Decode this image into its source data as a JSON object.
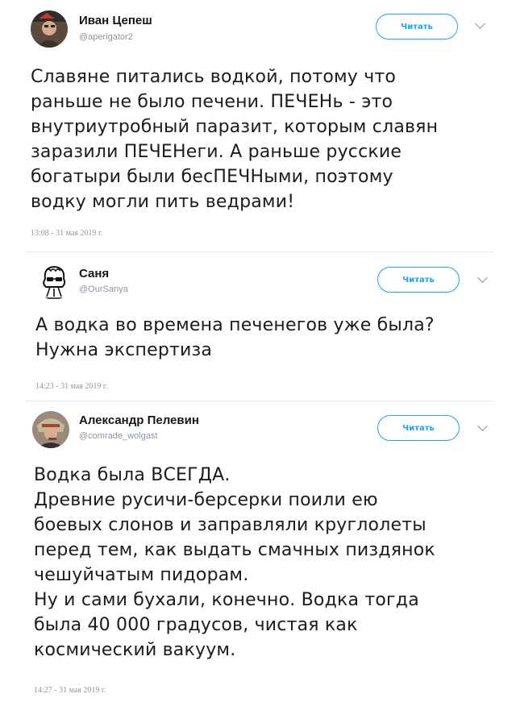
{
  "tweets": [
    {
      "name": "Иван Цепеш",
      "handle": "@aperigator2",
      "follow_label": "Читать",
      "text": "Славяне питались водкой, потому что\nраньше не было печени. ПЕЧЕНь - это\nвнутриутробный паразит, которым славян\nзаразили ПЕЧЕНеги. А раньше русские\nбогатыри были бесПЕЧНыми, поэтому\nводку могли пить ведрами!",
      "timestamp": "13:08 - 31 мая 2019 г."
    },
    {
      "name": "Саня",
      "handle": "@OurSanya",
      "follow_label": "Читать",
      "text": "А водка во времена печенегов уже была?\nНужна экспертиза",
      "timestamp": "14:23 - 31 мая 2019 г."
    },
    {
      "name": "Александр Пелевин",
      "handle": "@comrade_wolgast",
      "follow_label": "Читать",
      "text": "Водка была ВСЕГДА.\nДревние русичи-берсерки поили ею\nбоевых слонов и заправляли круглолеты\nперед тем, как выдать смачных пиздянок\nчешуйчатым пидорам.\nНу и сами бухали, конечно. Водка тогда\nбыла 40 000 градусов, чистая как\nкосмический вакуум.",
      "timestamp": "14:27 - 31 мая 2019 г."
    }
  ],
  "icons": {
    "avatar_1": "avatar-photo-icon",
    "avatar_2": "pushkin-sunglasses-avatar-icon",
    "avatar_3": "avatar-photo-icon",
    "menu": "chevron-down-icon"
  },
  "colors": {
    "accent": "#1da1f2",
    "text": "#14171a",
    "muted": "#8a96a3"
  }
}
